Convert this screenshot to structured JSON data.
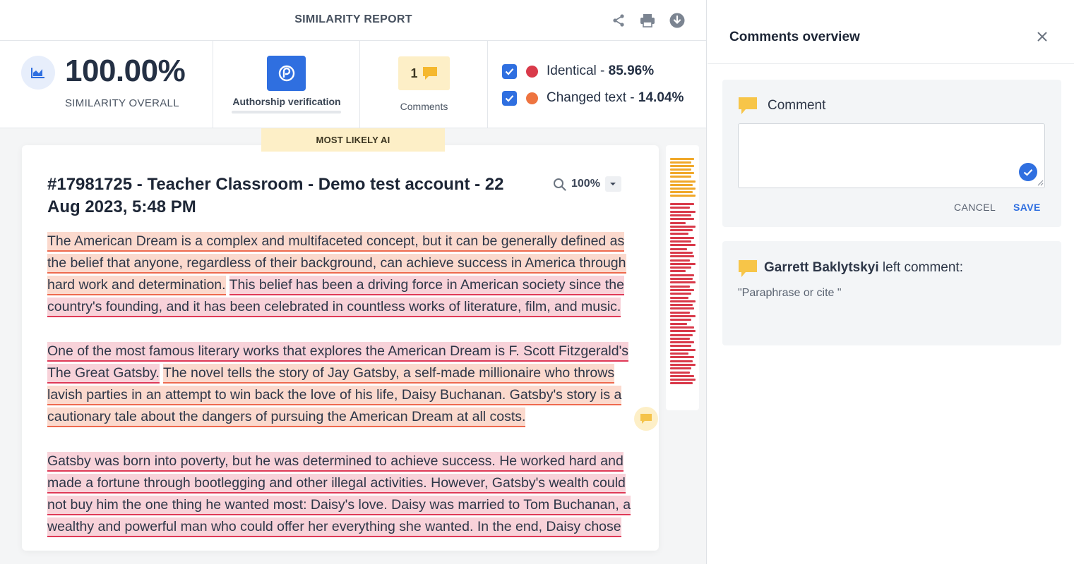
{
  "report": {
    "title": "SIMILARITY REPORT",
    "icons": [
      "share-icon",
      "print-icon",
      "download-icon"
    ]
  },
  "stats": {
    "similarity_value": "100.00%",
    "similarity_label": "SIMILARITY OVERALL",
    "authorship_label": "Authorship verification",
    "comments_count": "1",
    "comments_label": "Comments"
  },
  "legend": [
    {
      "label": "Identical - ",
      "value": "85.96%",
      "color": "#d93a4a",
      "checked": true
    },
    {
      "label": "Changed text - ",
      "value": "14.04%",
      "color": "#ee7440",
      "checked": true
    }
  ],
  "ai_tag": "MOST LIKELY AI",
  "document": {
    "title": "#17981725 - Teacher Classroom - Demo test account - 22 Aug 2023, 5:48 PM",
    "zoom": "100%",
    "paragraphs": [
      [
        {
          "text": "The American Dream is a complex and multifaceted concept, but it can be generally defined as the belief that anyone, regardless of their background, can achieve success in America through hard work and determination.",
          "kind": "changed"
        },
        {
          "text": " ",
          "kind": "none"
        },
        {
          "text": "This belief has been a driving force in American society since the country's founding, and it has been celebrated in countless works of literature, film, and music.",
          "kind": "identical"
        }
      ],
      [
        {
          "text": "One of the most famous literary works that explores the American Dream is F. Scott Fitzgerald's The Great Gatsby.",
          "kind": "identical"
        },
        {
          "text": " ",
          "kind": "none"
        },
        {
          "text": "The novel tells the story of Jay Gatsby, a self-made millionaire who throws lavish parties in an attempt to win back the love of his life, Daisy Buchanan. Gatsby's story is a cautionary tale about the dangers of pursuing the American Dream at all costs.",
          "kind": "changed"
        }
      ],
      [
        {
          "text": "Gatsby was born into poverty, but he was determined to achieve success. He worked hard and made a fortune through bootlegging and other illegal activities. However, Gatsby's wealth could not buy him the one thing he wanted most: Daisy's love. Daisy was married to Tom Buchanan, a wealthy and powerful man who could offer her everything she wanted. In the end, Daisy chose",
          "kind": "identical"
        }
      ]
    ]
  },
  "comments_panel": {
    "title": "Comments overview",
    "new_comment_label": "Comment",
    "input_value": "",
    "cancel_label": "CANCEL",
    "save_label": "SAVE",
    "existing": {
      "author": "Garrett Baklytskyi",
      "action": " left comment:",
      "text": "\"Paraphrase or cite \""
    }
  },
  "colors": {
    "accent": "#2f6fe0",
    "identical": "#d93a4a",
    "changed": "#ee7440",
    "ai_tag": "#fdefc7",
    "comment_icon": "#f7c548"
  }
}
